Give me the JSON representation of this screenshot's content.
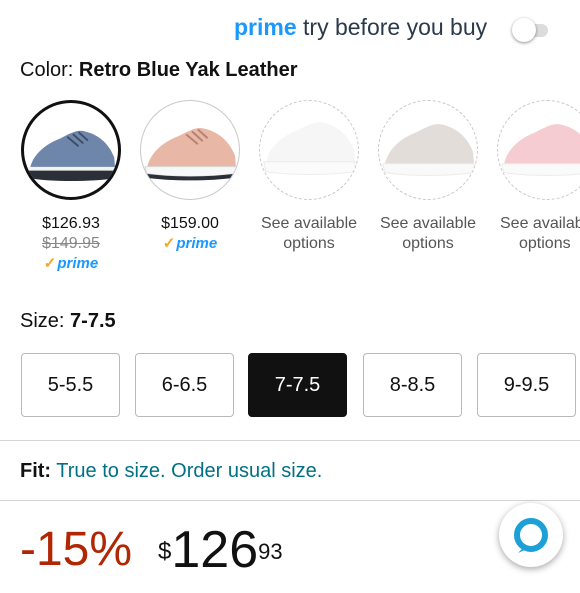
{
  "prime_try": {
    "prime": "prime",
    "text": "try before you buy",
    "enabled": false
  },
  "color": {
    "label": "Color:",
    "value": "Retro Blue Yak Leather"
  },
  "swatches": [
    {
      "name": "blue",
      "color": "#6f86ab",
      "price": "$126.93",
      "list_price": "$149.95",
      "prime": "prime",
      "selected": true
    },
    {
      "name": "blush",
      "color": "#e8b7a6",
      "price": "$159.00",
      "prime": "prime"
    },
    {
      "name": "white",
      "color": "#e9e9e9",
      "line1": "See available",
      "line2": "options"
    },
    {
      "name": "grey",
      "color": "#c8bcb6",
      "line1": "See available",
      "line2": "options"
    },
    {
      "name": "pink",
      "color": "#e79aa3",
      "line1": "See available",
      "line2": "options"
    }
  ],
  "size": {
    "label": "Size:",
    "value": "7-7.5",
    "options": [
      "5-5.5",
      "6-6.5",
      "7-7.5",
      "8-8.5",
      "9-9.5"
    ],
    "selected_index": 2
  },
  "fit": {
    "label": "Fit:",
    "value": "True to size. Order usual size."
  },
  "price": {
    "discount": "-15%",
    "currency": "$",
    "whole": "126",
    "fraction": "93"
  },
  "colors": {
    "prime_blue": "#1a98ff",
    "check_orange": "#f5a623",
    "discount_red": "#b12704",
    "fit_link": "#007185",
    "alexa": "#1ca0d7"
  }
}
